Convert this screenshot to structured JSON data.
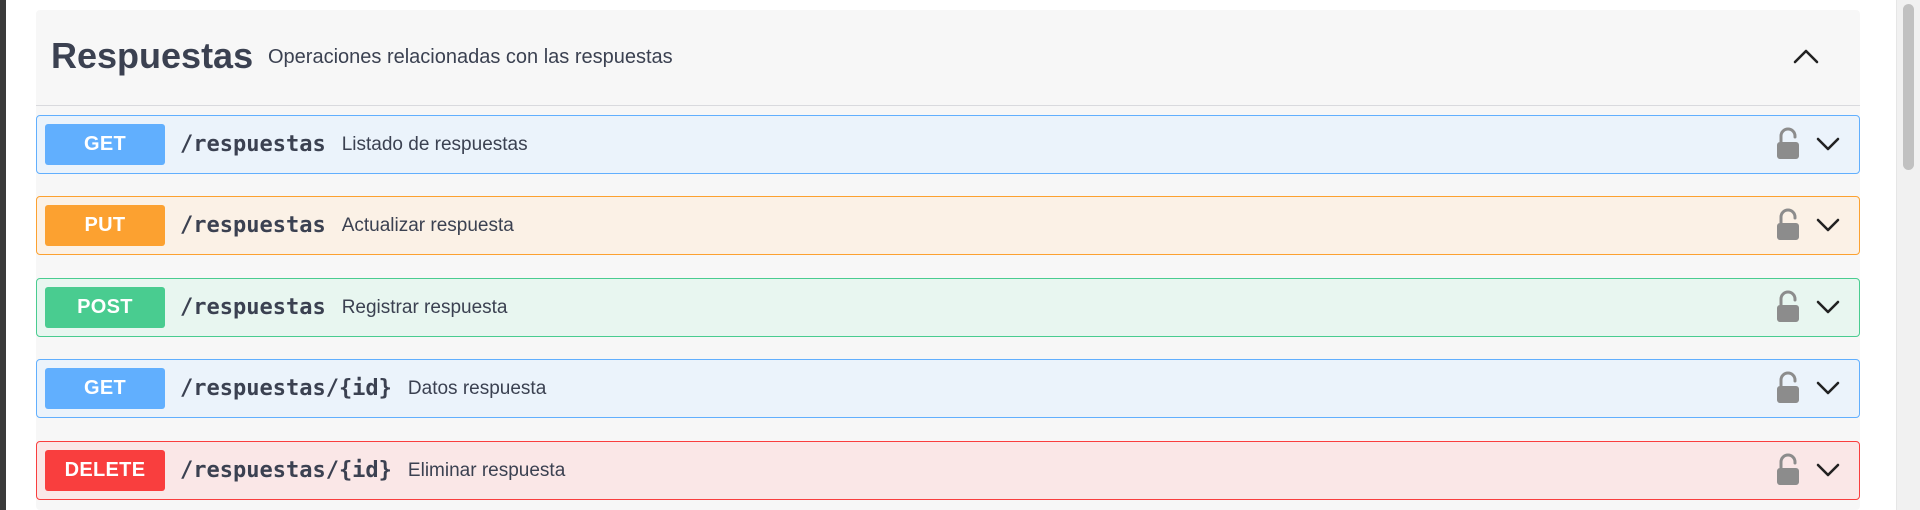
{
  "tag": {
    "title": "Respuestas",
    "description": "Operaciones relacionadas con las respuestas"
  },
  "operations": [
    {
      "method": "GET",
      "path": "/respuestas",
      "summary": "Listado de respuestas"
    },
    {
      "method": "PUT",
      "path": "/respuestas",
      "summary": "Actualizar respuesta"
    },
    {
      "method": "POST",
      "path": "/respuestas",
      "summary": "Registrar respuesta"
    },
    {
      "method": "GET",
      "path": "/respuestas/{id}",
      "summary": "Datos respuesta"
    },
    {
      "method": "DELETE",
      "path": "/respuestas/{id}",
      "summary": "Eliminar respuesta"
    }
  ],
  "icons": {
    "collapse": "chevron-up-icon",
    "expand": "chevron-down-icon",
    "auth": "lock-icon"
  },
  "colors": {
    "get": "#61affe",
    "put": "#fca130",
    "post": "#49cc90",
    "delete": "#f93e3e"
  }
}
